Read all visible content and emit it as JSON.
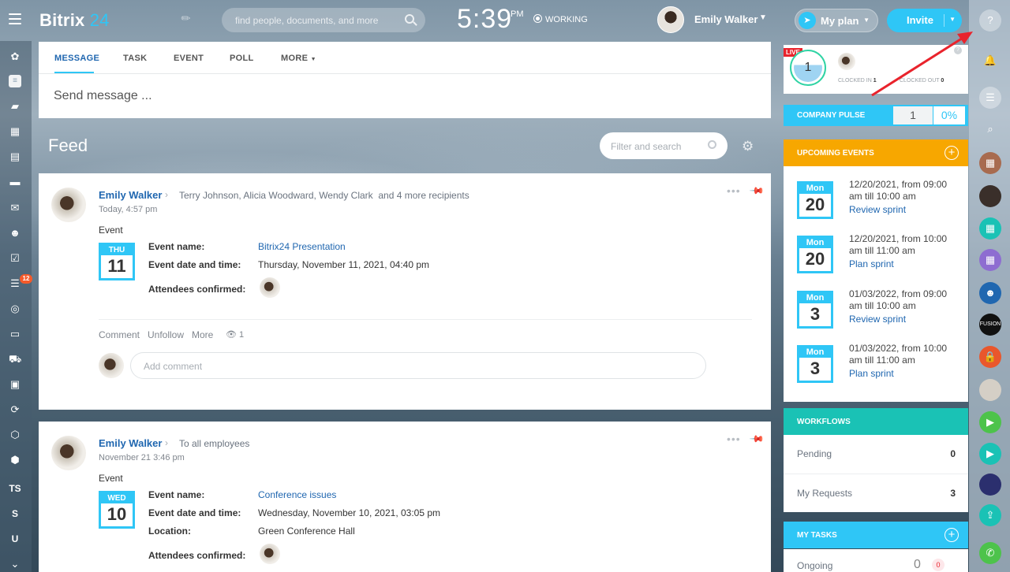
{
  "topbar": {
    "logo_main": "Bitrix",
    "logo_num": "24",
    "search_placeholder": "find people, documents, and more",
    "clock_time": "5:39",
    "clock_ampm": "PM",
    "work_status": "WORKING",
    "user_name": "Emily Walker",
    "myplan_label": "My plan",
    "invite_label": "Invite"
  },
  "left_sidebar": {
    "tasks_badge": "12",
    "text_items": [
      "TS",
      "S",
      "U"
    ]
  },
  "composer": {
    "tabs": [
      "MESSAGE",
      "TASK",
      "EVENT",
      "POLL",
      "MORE"
    ],
    "placeholder": "Send message ..."
  },
  "feed": {
    "title": "Feed",
    "filter_placeholder": "Filter and search"
  },
  "posts": [
    {
      "author": "Emily Walker",
      "recipients": "Terry Johnson, Alicia Woodward, Wendy Clark",
      "more_recipients": "and 4 more recipients",
      "date": "Today, 4:57 pm",
      "kind": "Event",
      "cal_dow": "THU",
      "cal_day": "11",
      "event_name_label": "Event name:",
      "event_name": "Bitrix24 Presentation",
      "event_date_label": "Event date and time:",
      "event_date": "Thursday, November 11, 2021, 04:40 pm",
      "attendees_label": "Attendees confirmed:",
      "actions": {
        "comment": "Comment",
        "unfollow": "Unfollow",
        "more": "More",
        "views": "1"
      },
      "comment_placeholder": "Add comment"
    },
    {
      "author": "Emily Walker",
      "recipients": "To all employees",
      "date": "November 21 3:46 pm",
      "kind": "Event",
      "cal_dow": "WED",
      "cal_day": "10",
      "event_name_label": "Event name:",
      "event_name": "Conference issues",
      "event_date_label": "Event date and time:",
      "event_date": "Wednesday, November 10, 2021, 03:05 pm",
      "location_label": "Location:",
      "location": "Green Conference Hall",
      "attendees_label": "Attendees confirmed:"
    }
  ],
  "live": {
    "tag": "LIVE",
    "count": "1",
    "clocked_in_label": "CLOCKED IN",
    "clocked_in": "1",
    "clocked_out_label": "CLOCKED OUT",
    "clocked_out": "0"
  },
  "pulse": {
    "label": "COMPANY PULSE",
    "count": "1",
    "percent": "0%"
  },
  "upcoming": {
    "title": "UPCOMING EVENTS",
    "color": "#f7a700",
    "events": [
      {
        "dow": "Mon",
        "day": "20",
        "line1": "12/20/2021, from 09:00",
        "line2": "am till 10:00 am",
        "name": "Review sprint"
      },
      {
        "dow": "Mon",
        "day": "20",
        "line1": "12/20/2021, from 10:00",
        "line2": "am till 11:00 am",
        "name": "Plan sprint"
      },
      {
        "dow": "Mon",
        "day": "3",
        "line1": "01/03/2022, from 09:00",
        "line2": "am till 10:00 am",
        "name": "Review sprint"
      },
      {
        "dow": "Mon",
        "day": "3",
        "line1": "01/03/2022, from 10:00",
        "line2": "am till 11:00 am",
        "name": "Plan sprint"
      }
    ]
  },
  "workflows": {
    "title": "WORKFLOWS",
    "color": "#1ac2b5",
    "rows": [
      {
        "label": "Pending",
        "count": "0"
      },
      {
        "label": "My Requests",
        "count": "3"
      }
    ]
  },
  "my_tasks": {
    "title": "MY TASKS",
    "row_label": "Ongoing",
    "count": "0",
    "badge": "0"
  },
  "colors": {
    "accent": "#2fc6f6",
    "link": "#2067b0",
    "live_red": "#e9232c"
  }
}
